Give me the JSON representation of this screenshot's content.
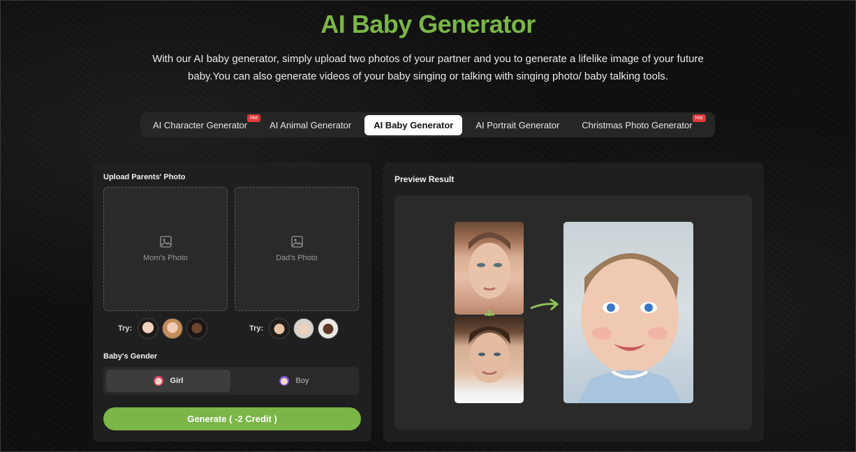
{
  "header": {
    "title": "AI Baby Generator",
    "description": "With our AI baby generator, simply upload two photos of your partner and you to generate a lifelike image of your future baby.You can also generate videos of your baby singing or talking with singing photo/ baby talking tools."
  },
  "tabs": [
    {
      "label": "AI Character Generator",
      "badge": "Hot"
    },
    {
      "label": "AI Animal Generator"
    },
    {
      "label": "AI Baby Generator",
      "active": true
    },
    {
      "label": "AI Portrait Generator"
    },
    {
      "label": "Christmas Photo Generator",
      "badge": "Hot"
    }
  ],
  "upload": {
    "section_label": "Upload Parents' Photo",
    "mom_label": "Mom's Photo",
    "dad_label": "Dad's Photo",
    "try_label": "Try:"
  },
  "gender": {
    "section_label": "Baby's Gender",
    "girl_label": "Girl",
    "boy_label": "Boy",
    "selected": "Girl"
  },
  "generate_label": "Generate ( -2 Credit )",
  "preview": {
    "label": "Preview Result"
  },
  "colors": {
    "accent": "#7ab648",
    "hot_badge": "#e23b3b"
  }
}
